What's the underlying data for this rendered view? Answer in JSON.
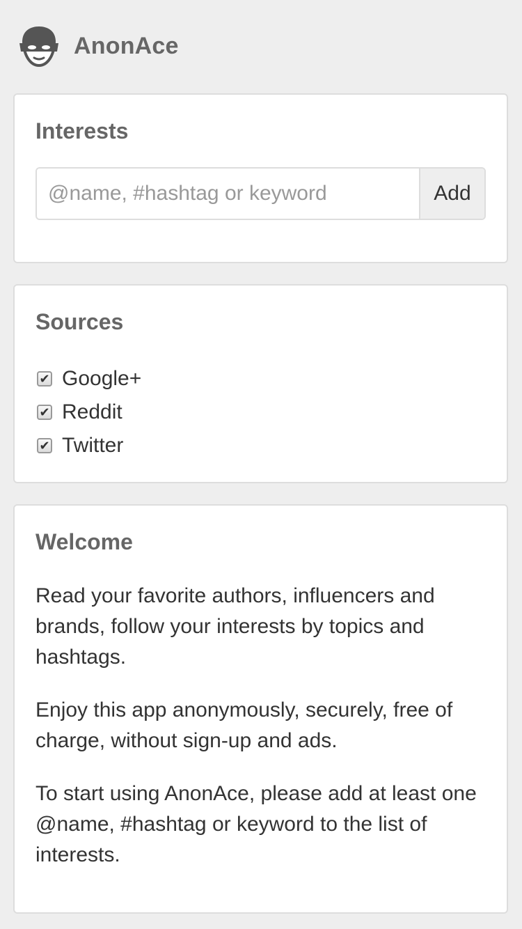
{
  "header": {
    "title": "AnonAce",
    "logo_icon": "masked-face-icon"
  },
  "interests": {
    "title": "Interests",
    "input_placeholder": "@name, #hashtag or keyword",
    "input_value": "",
    "add_label": "Add"
  },
  "sources": {
    "title": "Sources",
    "items": [
      {
        "label": "Google+",
        "checked": true
      },
      {
        "label": "Reddit",
        "checked": true
      },
      {
        "label": "Twitter",
        "checked": true
      }
    ]
  },
  "welcome": {
    "title": "Welcome",
    "paragraphs": [
      "Read your favorite authors, influencers and brands, follow your interests by topics and hashtags.",
      "Enjoy this app anonymously, securely, free of charge, without sign-up and ads.",
      "To start using AnonAce, please add at least one @name, #hashtag or keyword to the list of interests."
    ]
  },
  "colors": {
    "background": "#eeeeee",
    "card": "#ffffff",
    "border": "#dddddd",
    "heading": "#666666",
    "text": "#333333"
  }
}
